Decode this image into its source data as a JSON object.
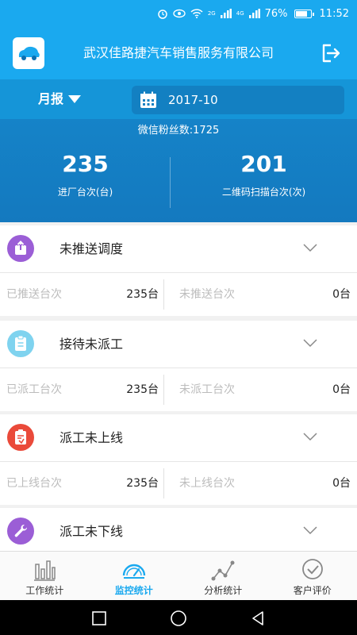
{
  "status_bar": {
    "battery": "76%",
    "time": "11:52",
    "net_2g": "2G",
    "net_4g": "4G"
  },
  "header": {
    "title": "武汉佳路捷汽车销售服务有限公司"
  },
  "filter": {
    "report_type": "月报",
    "date": "2017-10"
  },
  "stats": {
    "fans_text": "微信粉丝数:1725",
    "left": {
      "value": "235",
      "label": "进厂台次(台)"
    },
    "right": {
      "value": "201",
      "label": "二维码扫描台次(次)"
    }
  },
  "cards": [
    {
      "title": "未推送调度",
      "icon": "upload-icon",
      "color": "#9b5ed6",
      "left_label": "已推送台次",
      "left_value": "235台",
      "right_label": "未推送台次",
      "right_value": "0台"
    },
    {
      "title": "接待未派工",
      "icon": "clipboard-icon",
      "color": "#7fd3ef",
      "left_label": "已派工台次",
      "left_value": "235台",
      "right_label": "未派工台次",
      "right_value": "0台"
    },
    {
      "title": "派工未上线",
      "icon": "document-icon",
      "color": "#ea4a3a",
      "left_label": "已上线台次",
      "left_value": "235台",
      "right_label": "未上线台次",
      "right_value": "0台"
    },
    {
      "title": "派工未下线",
      "icon": "wrench-icon",
      "color": "#9b5ed6"
    }
  ],
  "bottom_nav": [
    {
      "label": "工作统计",
      "icon": "bar-chart-icon",
      "active": false
    },
    {
      "label": "监控统计",
      "icon": "gauge-icon",
      "active": true
    },
    {
      "label": "分析统计",
      "icon": "line-chart-icon",
      "active": false
    },
    {
      "label": "客户评价",
      "icon": "check-circle-icon",
      "active": false
    }
  ],
  "colors": {
    "primary": "#1aa9ef",
    "filter_bg": "#1595d8",
    "stats_bg": "#1583c8",
    "active_nav": "#1aa9ef"
  }
}
